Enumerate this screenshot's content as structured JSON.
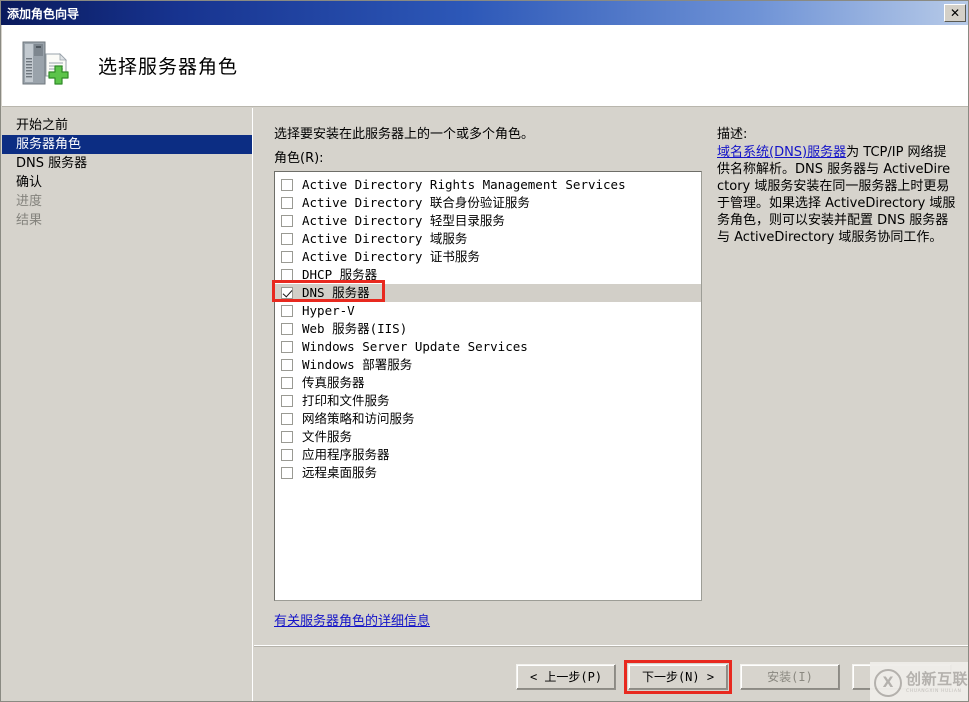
{
  "window": {
    "title": "添加角色向导",
    "close_label": "✕"
  },
  "header": {
    "title": "选择服务器角色",
    "icon": "server-add-icon"
  },
  "sidebar": {
    "items": [
      {
        "label": "开始之前",
        "state": "normal"
      },
      {
        "label": "服务器角色",
        "state": "active"
      },
      {
        "label": "DNS 服务器",
        "state": "normal"
      },
      {
        "label": "确认",
        "state": "normal"
      },
      {
        "label": "进度",
        "state": "dim"
      },
      {
        "label": "结果",
        "state": "dim"
      }
    ]
  },
  "main": {
    "lead_text": "选择要安装在此服务器上的一个或多个角色。",
    "roles_label": "角色(R):",
    "more_info_link": "有关服务器角色的详细信息",
    "roles": [
      {
        "label": "Active Directory Rights Management Services",
        "checked": false,
        "selected": false
      },
      {
        "label": "Active Directory 联合身份验证服务",
        "checked": false,
        "selected": false
      },
      {
        "label": "Active Directory 轻型目录服务",
        "checked": false,
        "selected": false
      },
      {
        "label": "Active Directory 域服务",
        "checked": false,
        "selected": false
      },
      {
        "label": "Active Directory 证书服务",
        "checked": false,
        "selected": false
      },
      {
        "label": "DHCP 服务器",
        "checked": false,
        "selected": false
      },
      {
        "label": "DNS 服务器",
        "checked": true,
        "selected": true
      },
      {
        "label": "Hyper-V",
        "checked": false,
        "selected": false
      },
      {
        "label": "Web 服务器(IIS)",
        "checked": false,
        "selected": false
      },
      {
        "label": "Windows Server Update Services",
        "checked": false,
        "selected": false
      },
      {
        "label": "Windows 部署服务",
        "checked": false,
        "selected": false
      },
      {
        "label": "传真服务器",
        "checked": false,
        "selected": false
      },
      {
        "label": "打印和文件服务",
        "checked": false,
        "selected": false
      },
      {
        "label": "网络策略和访问服务",
        "checked": false,
        "selected": false
      },
      {
        "label": "文件服务",
        "checked": false,
        "selected": false
      },
      {
        "label": "应用程序服务器",
        "checked": false,
        "selected": false
      },
      {
        "label": "远程桌面服务",
        "checked": false,
        "selected": false
      }
    ]
  },
  "description": {
    "title": "描述:",
    "link_text": "域名系统(DNS)服务器",
    "body_text": "为 TCP/IP 网络提供名称解析。DNS 服务器与 ActiveDirectory 域服务安装在同一服务器上时更易于管理。如果选择 ActiveDirectory 域服务角色，则可以安装并配置 DNS 服务器与 ActiveDirectory 域服务协同工作。"
  },
  "footer": {
    "buttons": [
      {
        "label": "< 上一步(P)",
        "name": "previous-button",
        "disabled": false,
        "highlighted": false
      },
      {
        "label": "下一步(N) >",
        "name": "next-button",
        "disabled": false,
        "highlighted": true
      },
      {
        "label": "安装(I)",
        "name": "install-button",
        "disabled": true,
        "highlighted": false
      },
      {
        "label": "",
        "name": "cancel-button",
        "disabled": false,
        "highlighted": false
      }
    ]
  },
  "watermark": {
    "main_text": "创新互联",
    "sub_text": "CHUANGXIN HULIAN"
  },
  "colors": {
    "accent": "#0c2d83",
    "annotation": "#e8291f",
    "link": "#1414c8",
    "window_bg": "#d6d3cc"
  }
}
